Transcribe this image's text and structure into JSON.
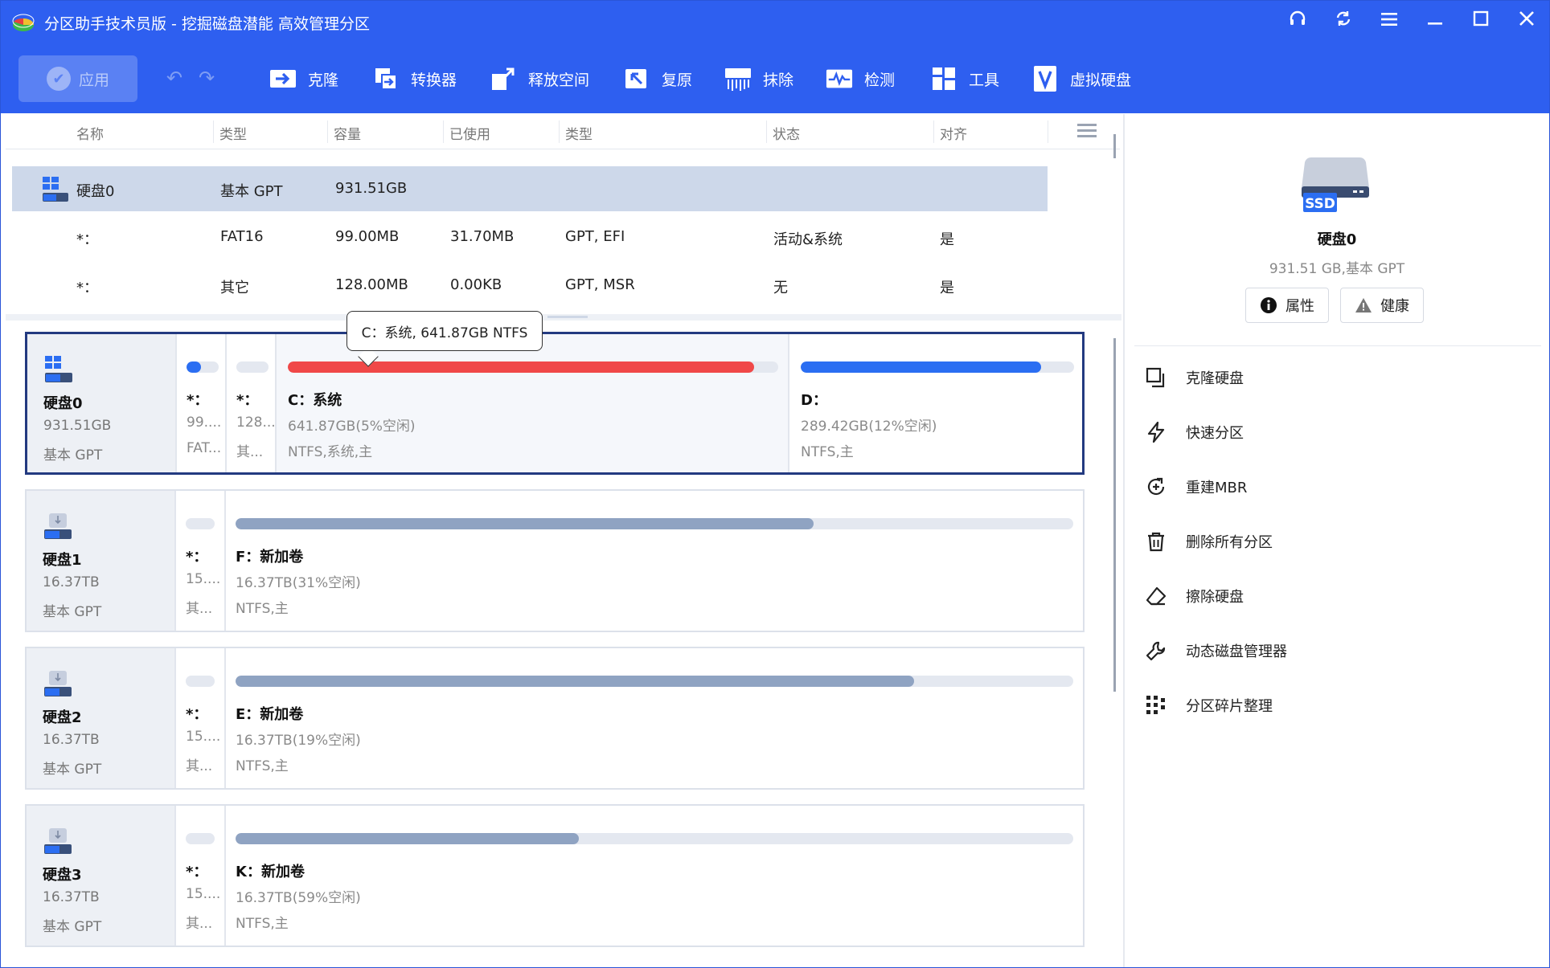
{
  "title": {
    "text": "分区助手技术员版 - 挖掘磁盘潜能 高效管理分区"
  },
  "toolbar": {
    "apply": "应用",
    "items": [
      "克隆",
      "转换器",
      "释放空间",
      "复原",
      "抹除",
      "检测",
      "工具",
      "虚拟硬盘"
    ]
  },
  "table": {
    "headers": [
      "名称",
      "类型",
      "容量",
      "已使用",
      "类型",
      "状态",
      "对齐"
    ],
    "rows": [
      {
        "name": "硬盘0",
        "type": "基本 GPT",
        "capacity": "931.51GB",
        "used": "",
        "fs": "",
        "status": "",
        "align": ""
      },
      {
        "name": "*：",
        "type": "FAT16",
        "capacity": "99.00MB",
        "used": "31.70MB",
        "fs": "GPT, EFI",
        "status": "活动&系统",
        "align": "是"
      },
      {
        "name": "*：",
        "type": "其它",
        "capacity": "128.00MB",
        "used": "0.00KB",
        "fs": "GPT, MSR",
        "status": "无",
        "align": "是"
      }
    ]
  },
  "tooltip": "C：系统, 641.87GB NTFS",
  "disks": [
    {
      "name": "硬盘0",
      "size": "931.51GB",
      "type": "基本 GPT",
      "kind": "SSD",
      "parts": [
        {
          "name": "*：",
          "cap": "99....",
          "fs": "FAT...",
          "fill": 0.45
        },
        {
          "name": "*：",
          "cap": "128...",
          "fs": "其...",
          "fill": 0.0
        },
        {
          "name": "C：系统",
          "cap": "641.87GB(5%空闲)",
          "fs": "NTFS,系统,主",
          "fill": 0.95
        },
        {
          "name": "D：",
          "cap": "289.42GB(12%空闲)",
          "fs": "NTFS,主",
          "fill": 0.88
        }
      ]
    },
    {
      "name": "硬盘1",
      "size": "16.37TB",
      "type": "基本 GPT",
      "kind": "HDD",
      "parts": [
        {
          "name": "*：",
          "cap": "15....",
          "fs": "其...",
          "fill": 0.0
        },
        {
          "name": "F：新加卷",
          "cap": "16.37TB(31%空闲)",
          "fs": "NTFS,主",
          "fill": 0.69
        }
      ]
    },
    {
      "name": "硬盘2",
      "size": "16.37TB",
      "type": "基本 GPT",
      "kind": "HDD",
      "parts": [
        {
          "name": "*：",
          "cap": "15....",
          "fs": "其...",
          "fill": 0.0
        },
        {
          "name": "E：新加卷",
          "cap": "16.37TB(19%空闲)",
          "fs": "NTFS,主",
          "fill": 0.81
        }
      ]
    },
    {
      "name": "硬盘3",
      "size": "16.37TB",
      "type": "基本 GPT",
      "kind": "HDD",
      "parts": [
        {
          "name": "*：",
          "cap": "15....",
          "fs": "其...",
          "fill": 0.0
        },
        {
          "name": "K：新加卷",
          "cap": "16.37TB(59%空闲)",
          "fs": "NTFS,主",
          "fill": 0.41
        }
      ]
    }
  ],
  "panel": {
    "disk_name": "硬盘0",
    "disk_sub": "931.51 GB,基本 GPT",
    "ssd_label": "SSD",
    "props_btn": "属性",
    "health_btn": "健康",
    "ops": [
      "克隆硬盘",
      "快速分区",
      "重建MBR",
      "删除所有分区",
      "擦除硬盘",
      "动态磁盘管理器",
      "分区碎片整理"
    ]
  },
  "colors": {
    "accent": "#2e5ff0",
    "system_bar": "#f04848",
    "data_bar": "#2b6ef2",
    "hdd_bar": "#8fa3c2"
  }
}
